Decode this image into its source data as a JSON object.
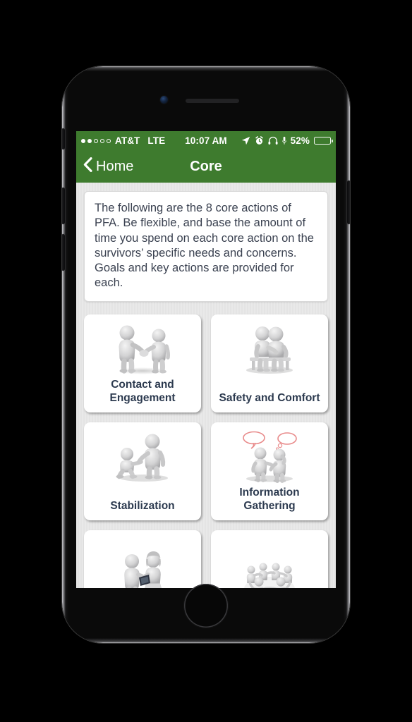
{
  "device": {
    "front_camera": "front-camera",
    "earpiece": "earpiece-speaker",
    "home_button": "home-button",
    "buttons": [
      "mute-switch",
      "volume-up",
      "volume-down",
      "power-button"
    ]
  },
  "status_bar": {
    "signal_dots_filled": 2,
    "signal_dots_total": 5,
    "carrier": "AT&T",
    "network": "LTE",
    "time": "10:07 AM",
    "icons": [
      "location-arrow-icon",
      "alarm-clock-icon",
      "headphones-icon",
      "microphone-icon"
    ],
    "battery_percent": "52%",
    "battery_level": 52,
    "background_color": "#3e7b2e",
    "foreground_color": "#ffffff"
  },
  "nav_bar": {
    "back_icon": "back-chevron-icon",
    "back_label": "Home",
    "title": "Core",
    "background_color": "#3e7b2e"
  },
  "intro": {
    "text": "The following are the 8 core actions of PFA. Be flexible, and base the amount of time you spend on each core action on the survivors’ specific needs and concerns. Goals and key actions are provided for each."
  },
  "tiles": [
    {
      "label": "Contact and Engagement",
      "icon": "handshake-figures-icon"
    },
    {
      "label": "Safety and Comfort",
      "icon": "seated-figures-bench-icon"
    },
    {
      "label": "Stabilization",
      "icon": "helping-kneeling-figure-icon"
    },
    {
      "label": "Information Gathering",
      "icon": "speech-bubble-figures-icon"
    },
    {
      "label": "",
      "icon": "figures-with-clipboard-icon"
    },
    {
      "label": "",
      "icon": "circle-of-figures-icon"
    }
  ],
  "theme": {
    "accent_green": "#3e7b2e",
    "screen_background": "#e9e9e9",
    "card_background": "#ffffff",
    "label_color": "#2c3a4f",
    "body_text_color": "#3a4150",
    "speech_bubble_color": "#e88a8a"
  }
}
